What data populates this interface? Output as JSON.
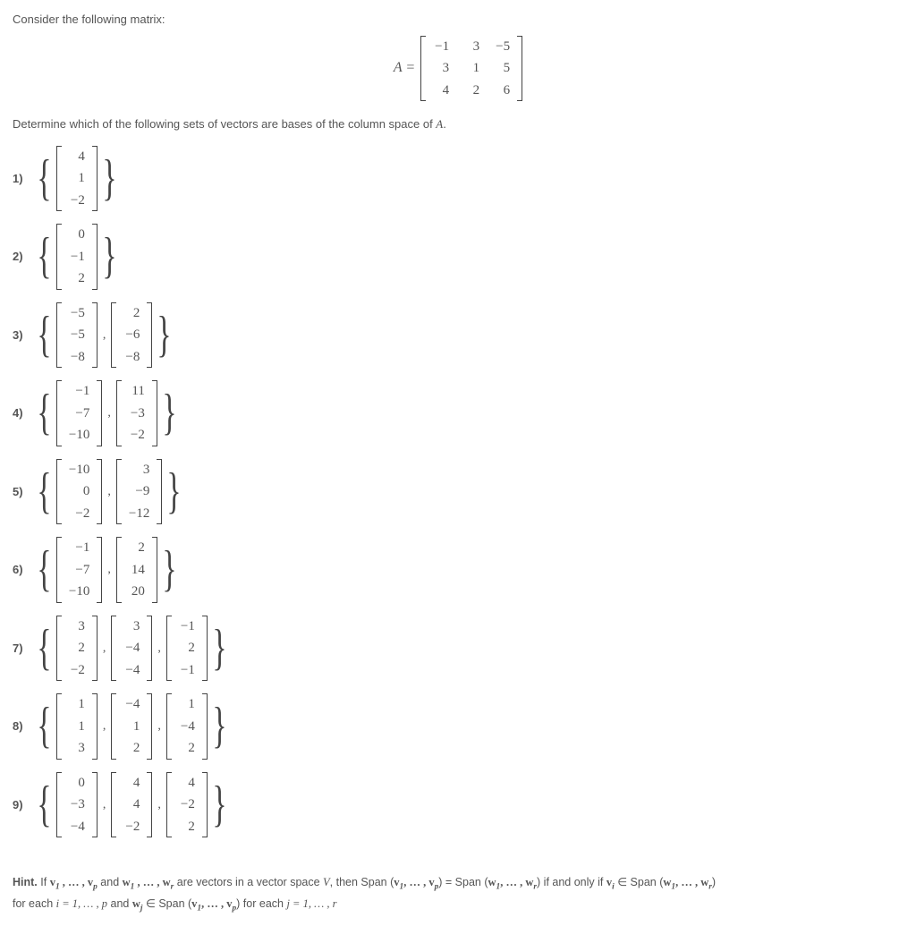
{
  "intro": "Consider the following matrix:",
  "matrix_label": "A =",
  "matrix": [
    [
      "−1",
      "3",
      "−5"
    ],
    [
      "3",
      "1",
      "5"
    ],
    [
      "4",
      "2",
      "6"
    ]
  ],
  "prompt_pre": "Determine which of the following sets of vectors are bases of the column space of ",
  "prompt_var": "A",
  "prompt_post": ".",
  "options": [
    {
      "num": "1)",
      "vectors": [
        [
          "4",
          "1",
          "−2"
        ]
      ]
    },
    {
      "num": "2)",
      "vectors": [
        [
          "0",
          "−1",
          "2"
        ]
      ]
    },
    {
      "num": "3)",
      "vectors": [
        [
          "−5",
          "−5",
          "−8"
        ],
        [
          "2",
          "−6",
          "−8"
        ]
      ]
    },
    {
      "num": "4)",
      "vectors": [
        [
          "−1",
          "−7",
          "−10"
        ],
        [
          "11",
          "−3",
          "−2"
        ]
      ]
    },
    {
      "num": "5)",
      "vectors": [
        [
          "−10",
          "0",
          "−2"
        ],
        [
          "3",
          "−9",
          "−12"
        ]
      ]
    },
    {
      "num": "6)",
      "vectors": [
        [
          "−1",
          "−7",
          "−10"
        ],
        [
          "2",
          "14",
          "20"
        ]
      ]
    },
    {
      "num": "7)",
      "vectors": [
        [
          "3",
          "2",
          "−2"
        ],
        [
          "3",
          "−4",
          "−4"
        ],
        [
          "−1",
          "2",
          "−1"
        ]
      ]
    },
    {
      "num": "8)",
      "vectors": [
        [
          "1",
          "1",
          "3"
        ],
        [
          "−4",
          "1",
          "2"
        ],
        [
          "1",
          "−4",
          "2"
        ]
      ]
    },
    {
      "num": "9)",
      "vectors": [
        [
          "0",
          "−3",
          "−4"
        ],
        [
          "4",
          "4",
          "−2"
        ],
        [
          "4",
          "−2",
          "2"
        ]
      ]
    }
  ],
  "hint": {
    "label": "Hint.",
    "t1": " If ",
    "v_seq1": "v₁ , … , v_p",
    "t2": " and ",
    "w_seq1": "w₁ , … , w_r",
    "t3": " are vectors in a vector space ",
    "Vname": "V",
    "t4": ", then Span (",
    "v_seq2": "v₁, … , v_p",
    "t5": ") = Span (",
    "w_seq2": "w₁, … , w_r",
    "t6": ") if and only if ",
    "vi": "v_i",
    "t7": " ∈ Span (",
    "w_seq3": "w₁, … , w_r",
    "t8": ")",
    "t9": " for each ",
    "ieq": "i = 1, … , p",
    "t10": " and ",
    "wj": "w_j",
    "t11": " ∈ Span (",
    "v_seq3": "v₁, … , v_p",
    "t12": ") for each ",
    "jeq": "j = 1, … , r"
  }
}
